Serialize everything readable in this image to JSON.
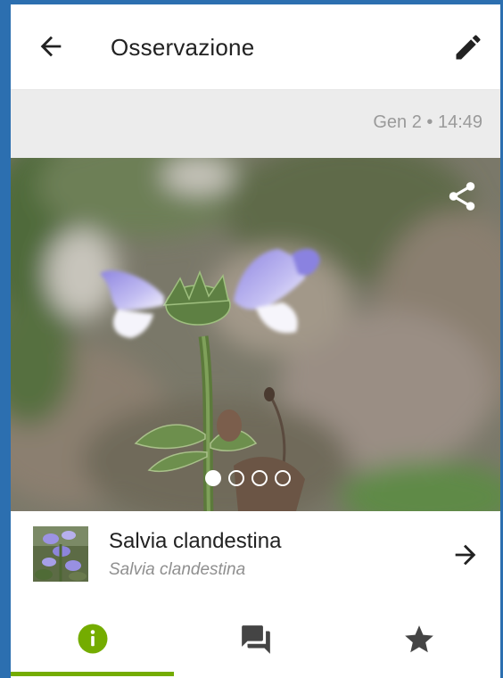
{
  "header": {
    "title": "Osservazione"
  },
  "observation": {
    "date_label": "Gen 2 • 14:49"
  },
  "gallery": {
    "photo_count": 4,
    "selected_index": 0
  },
  "taxon": {
    "common_name": "Salvia clandestina",
    "scientific_name": "Salvia clandestina"
  },
  "tabs": [
    {
      "id": "info",
      "icon": "info-icon",
      "selected": true
    },
    {
      "id": "activity",
      "icon": "comments-icon",
      "selected": false
    },
    {
      "id": "favorites",
      "icon": "star-icon",
      "selected": false
    }
  ],
  "colors": {
    "accent": "#74ac00",
    "border": "#2c6fb0",
    "date_bar": "#ececec",
    "muted_text": "#9a9a9a"
  }
}
